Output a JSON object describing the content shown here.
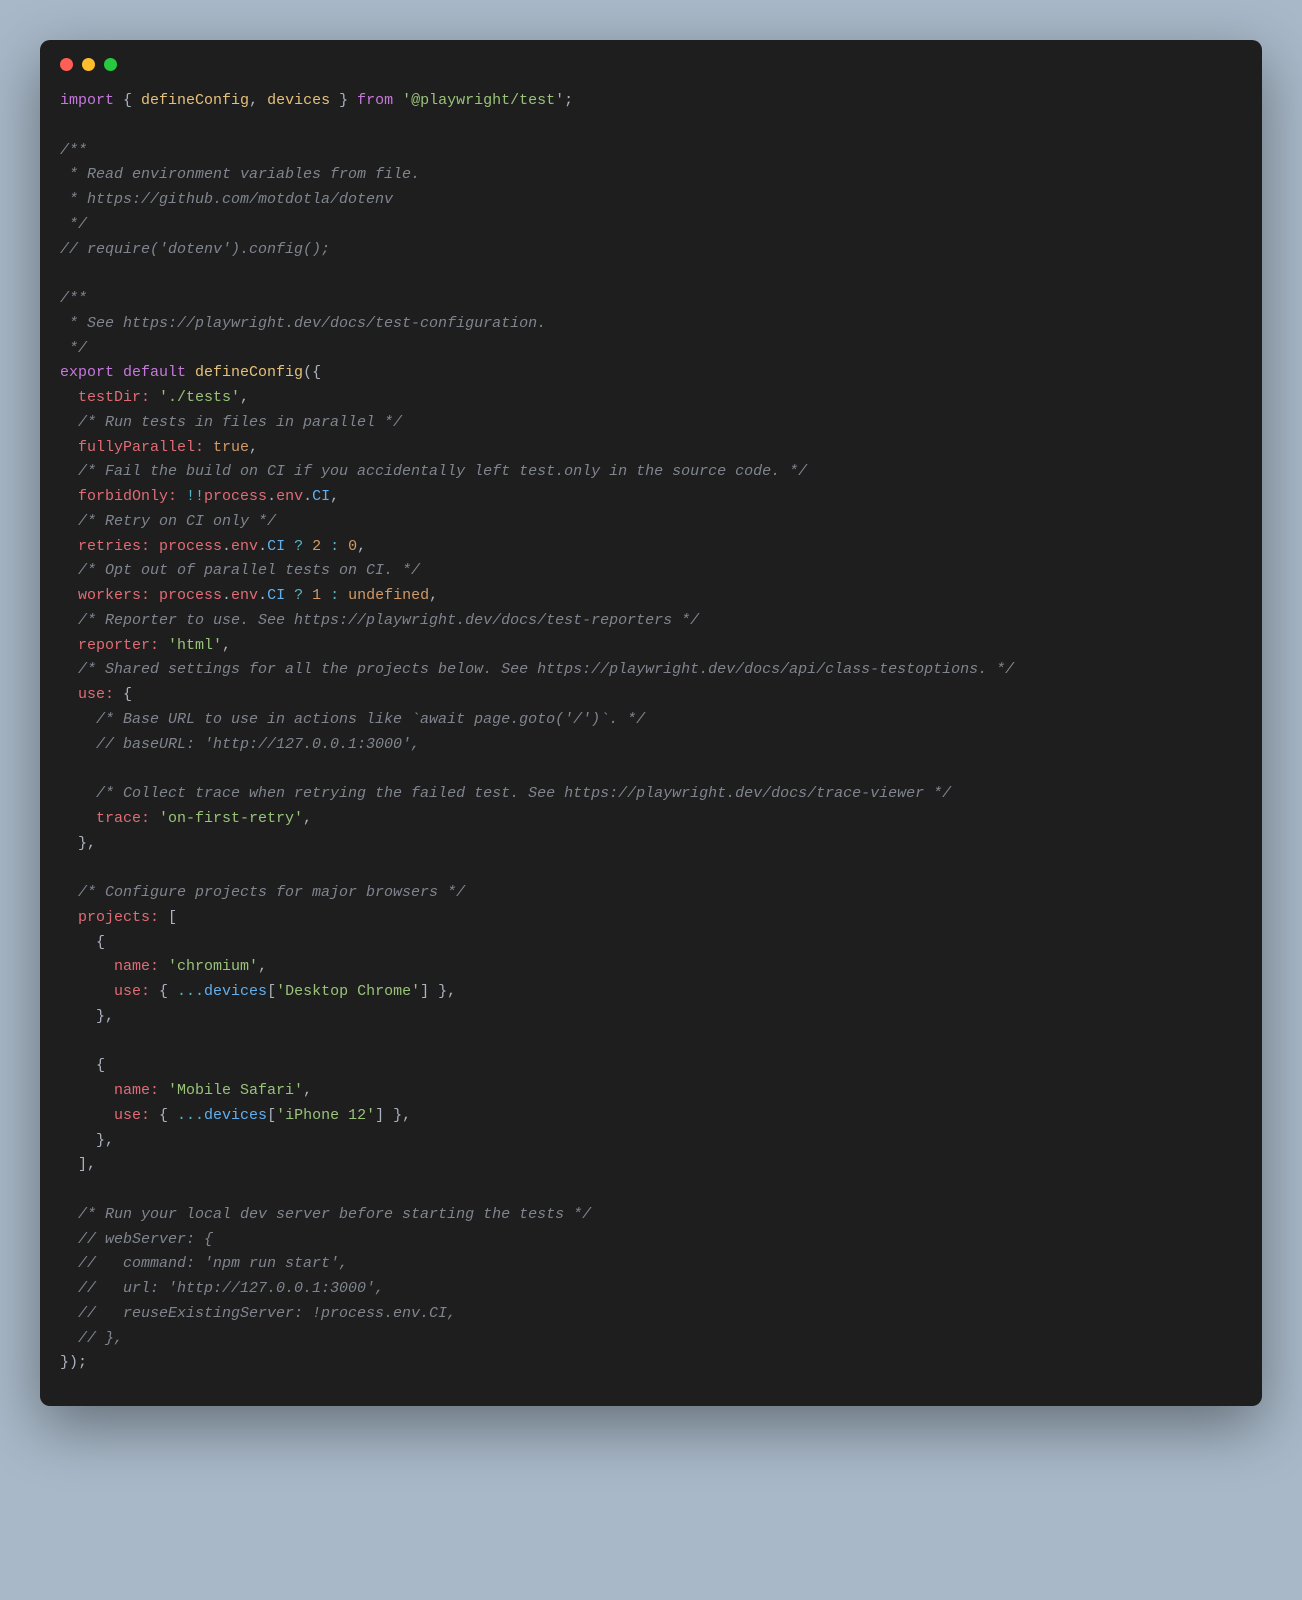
{
  "window": {
    "dots": [
      "red",
      "yellow",
      "green"
    ]
  },
  "code": {
    "line1_import": "import",
    "line1_brace_open": " { ",
    "line1_defineConfig": "defineConfig",
    "line1_comma": ", ",
    "line1_devices": "devices",
    "line1_brace_close": " } ",
    "line1_from": "from",
    "line1_space": " ",
    "line1_pkg": "'@playwright/test'",
    "line1_semi": ";",
    "comment_env": "/**\n * Read environment variables from file.\n * https://github.com/motdotla/dotenv\n */",
    "comment_require": "// require('dotenv').config();",
    "comment_see": "/**\n * See https://playwright.dev/docs/test-configuration.\n */",
    "export": "export",
    "default": " default ",
    "defineConfig_call": "defineConfig",
    "paren_open": "(",
    "obj_open": "{",
    "testDir_key": "  testDir:",
    "testDir_val": " './tests'",
    "comma": ",",
    "comment_parallel": "  /* Run tests in files in parallel */",
    "fullyParallel_key": "  fullyParallel:",
    "fullyParallel_val": " true",
    "comment_fail": "  /* Fail the build on CI if you accidentally left test.only in the source code. */",
    "forbidOnly_key": "  forbidOnly:",
    "forbidOnly_expr_bang": " !!",
    "forbidOnly_expr_proc": "process",
    "forbidOnly_expr_dot": ".",
    "forbidOnly_expr_env": "env",
    "forbidOnly_expr_dot2": ".",
    "forbidOnly_expr_ci": "CI",
    "comment_retry": "  /* Retry on CI only */",
    "retries_key": "  retries:",
    "retries_expr_proc": " process",
    "retries_expr_env": "env",
    "retries_expr_ci": "CI",
    "retries_expr_q": " ? ",
    "retries_expr_2": "2",
    "retries_expr_colon": " : ",
    "retries_expr_0": "0",
    "comment_workers": "  /* Opt out of parallel tests on CI. */",
    "workers_key": "  workers:",
    "workers_proc": " process",
    "workers_env": "env",
    "workers_ci": "CI",
    "workers_q": " ? ",
    "workers_1": "1",
    "workers_colon": " : ",
    "workers_undef": "undefined",
    "comment_reporter": "  /* Reporter to use. See https://playwright.dev/docs/test-reporters */",
    "reporter_key": "  reporter:",
    "reporter_val": " 'html'",
    "comment_shared": "  /* Shared settings for all the projects below. See https://playwright.dev/docs/api/class-testoptions. */",
    "use_key": "  use:",
    "use_open": " {",
    "comment_baseurl": "    /* Base URL to use in actions like `await page.goto('/')`. */",
    "comment_baseurl2": "    // baseURL: 'http://127.0.0.1:3000',",
    "comment_trace": "    /* Collect trace when retrying the failed test. See https://playwright.dev/docs/trace-viewer */",
    "trace_key": "    trace:",
    "trace_val": " 'on-first-retry'",
    "use_close": "  },",
    "comment_projects": "  /* Configure projects for major browsers */",
    "projects_key": "  projects:",
    "projects_open": " [",
    "p1_open": "    {",
    "p1_name_key": "      name:",
    "p1_name_val": " 'chromium'",
    "p1_use_key": "      use:",
    "p1_use_open": " { ",
    "p1_spread": "...",
    "p1_devices": "devices",
    "p1_bracket_open": "[",
    "p1_device_val": "'Desktop Chrome'",
    "p1_bracket_close": "]",
    "p1_use_close": " },",
    "p1_close": "    },",
    "p2_open": "    {",
    "p2_name_key": "      name:",
    "p2_name_val": " 'Mobile Safari'",
    "p2_use_key": "      use:",
    "p2_use_open": " { ",
    "p2_spread": "...",
    "p2_devices": "devices",
    "p2_bracket_open": "[",
    "p2_device_val": "'iPhone 12'",
    "p2_bracket_close": "]",
    "p2_use_close": " },",
    "p2_close": "    },",
    "projects_close": "  ],",
    "comment_webserver": "  /* Run your local dev server before starting the tests */",
    "comment_ws1": "  // webServer: {",
    "comment_ws2": "  //   command: 'npm run start',",
    "comment_ws3": "  //   url: 'http://127.0.0.1:3000',",
    "comment_ws4": "  //   reuseExistingServer: !process.env.CI,",
    "comment_ws5": "  // },",
    "obj_close": "}",
    "paren_close": ")",
    "final_semi": ";"
  }
}
